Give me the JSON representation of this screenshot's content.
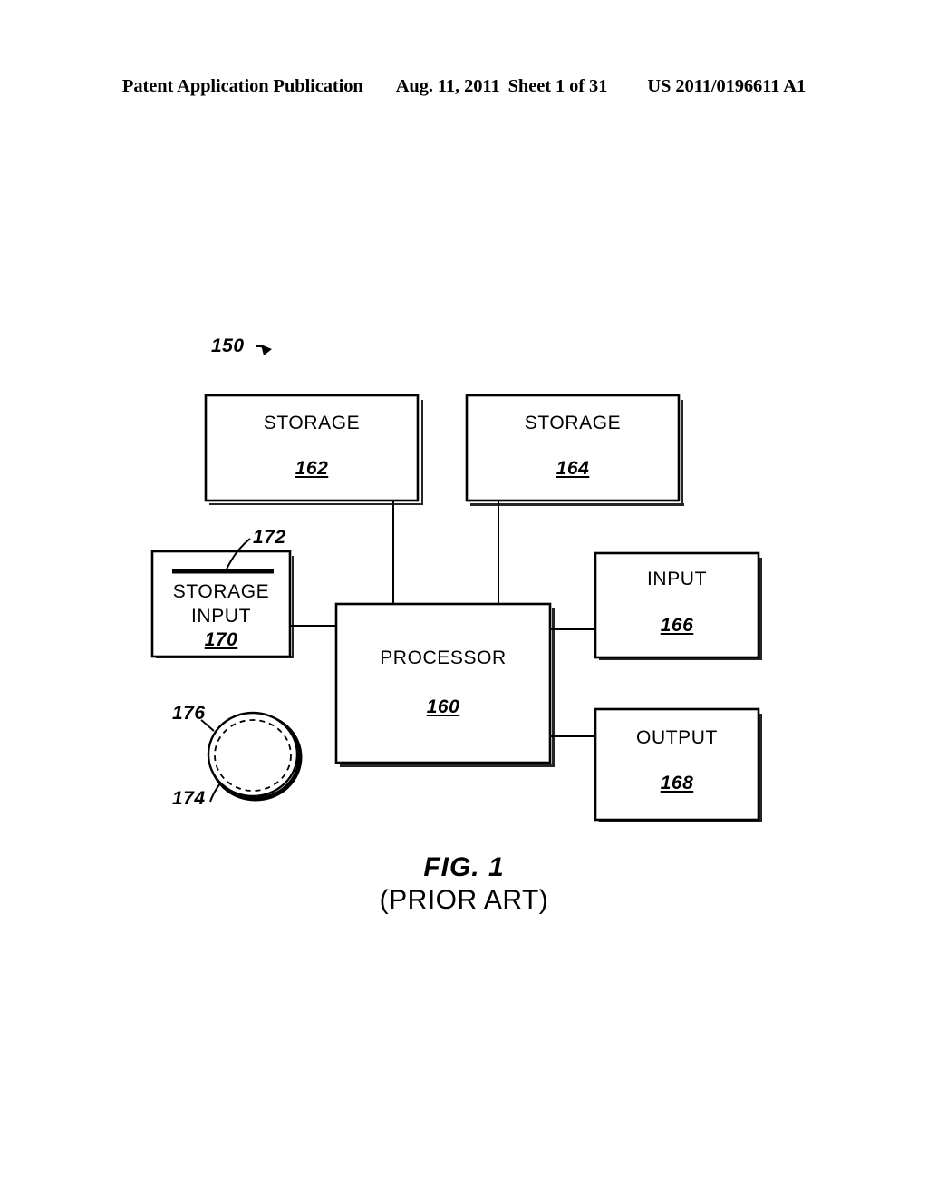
{
  "header": {
    "publication": "Patent Application Publication",
    "date": "Aug. 11, 2011",
    "sheet": "Sheet 1 of 31",
    "publication_number": "US 2011/0196611 A1"
  },
  "figure": {
    "system_ref": "150",
    "caption_title": "FIG. 1",
    "caption_subtitle": "(PRIOR ART)",
    "blocks": [
      {
        "id": "storage-162",
        "label": "STORAGE",
        "ref": "162"
      },
      {
        "id": "storage-164",
        "label": "STORAGE",
        "ref": "164"
      },
      {
        "id": "storage-input-170",
        "label_line1": "STORAGE",
        "label_line2": "INPUT",
        "ref": "170"
      },
      {
        "id": "processor-160",
        "label": "PROCESSOR",
        "ref": "160"
      },
      {
        "id": "input-166",
        "label": "INPUT",
        "ref": "166"
      },
      {
        "id": "output-168",
        "label": "OUTPUT",
        "ref": "168"
      }
    ],
    "leader_labels": [
      {
        "id": "slot-172",
        "ref": "172"
      },
      {
        "id": "disc-outer-176",
        "ref": "176"
      },
      {
        "id": "disc-inner-174",
        "ref": "174"
      }
    ]
  },
  "colors": {
    "ink": "#000000",
    "paper": "#ffffff"
  }
}
